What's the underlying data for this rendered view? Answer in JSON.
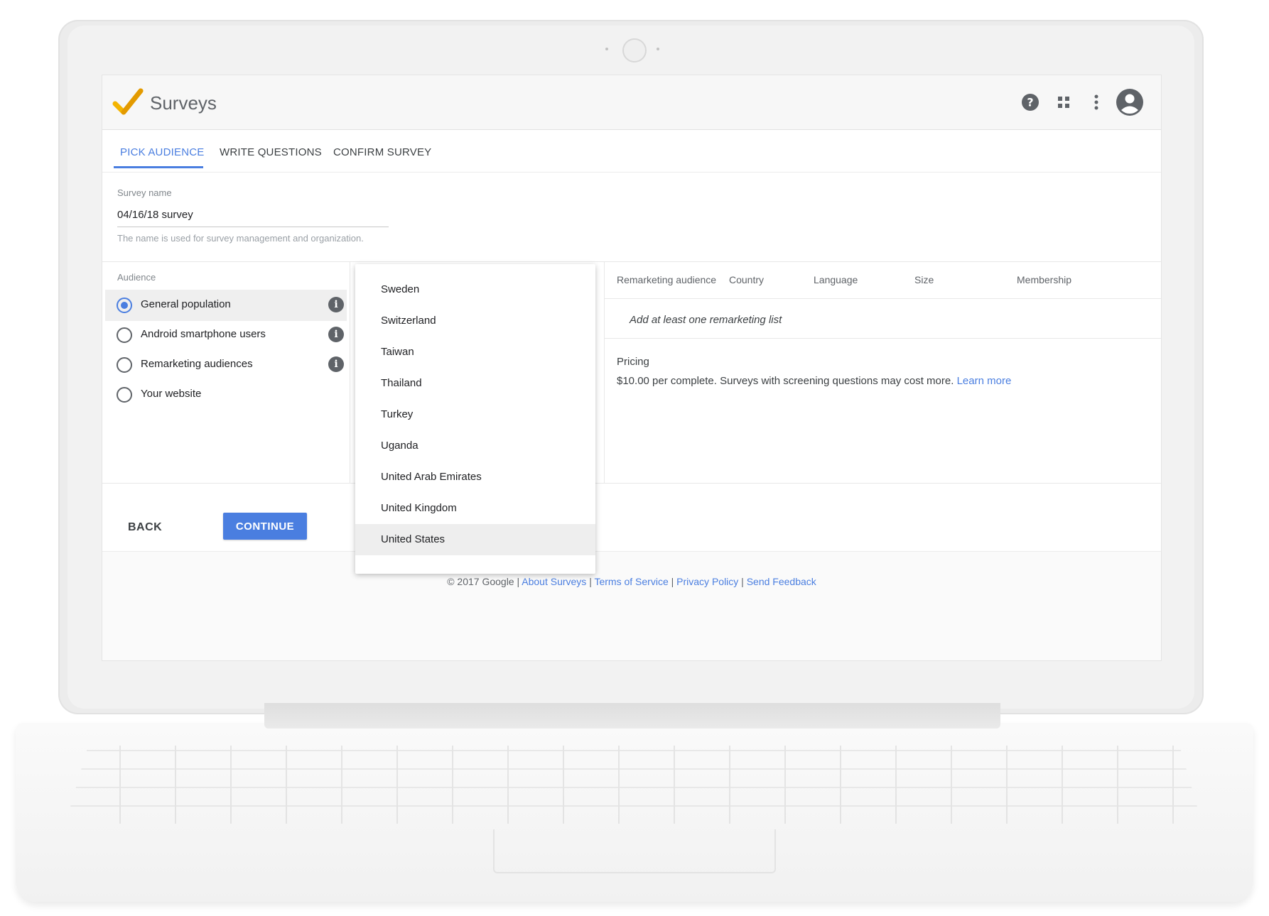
{
  "app": {
    "title": "Surveys"
  },
  "header_icons": [
    "help-icon",
    "apps-grid-icon",
    "more-vert-icon",
    "account-icon"
  ],
  "tabs": [
    {
      "label": "PICK AUDIENCE",
      "active": true
    },
    {
      "label": "WRITE QUESTIONS",
      "active": false
    },
    {
      "label": "CONFIRM SURVEY",
      "active": false
    }
  ],
  "survey_name": {
    "label": "Survey name",
    "value": "04/16/18 survey",
    "help": "The name is used for survey management and organization."
  },
  "audience": {
    "label": "Audience",
    "options": [
      {
        "label": "General population",
        "selected": true,
        "info": true
      },
      {
        "label": "Android smartphone users",
        "selected": false,
        "info": true
      },
      {
        "label": "Remarketing audiences",
        "selected": false,
        "info": true
      },
      {
        "label": "Your website",
        "selected": false,
        "info": false
      }
    ]
  },
  "country_dropdown": {
    "items": [
      "Sweden",
      "Switzerland",
      "Taiwan",
      "Thailand",
      "Turkey",
      "Uganda",
      "United Arab Emirates",
      "United Kingdom",
      "United States"
    ],
    "selected": "United States"
  },
  "remarketing_table": {
    "columns": [
      "Remarketing audience",
      "Country",
      "Language",
      "Size",
      "Membership"
    ],
    "empty_text": "Add at least one remarketing list"
  },
  "pricing": {
    "title": "Pricing",
    "text": "$10.00 per complete. Surveys with screening questions may cost more.",
    "link": "Learn more"
  },
  "actions": {
    "back": "BACK",
    "continue": "CONTINUE"
  },
  "footer": {
    "copyright": "© 2017 Google",
    "links": [
      "About Surveys",
      "Terms of Service",
      "Privacy Policy",
      "Send Feedback"
    ]
  },
  "colors": {
    "accent": "#4a7ee0",
    "logo_yellow": "#f4b400"
  }
}
